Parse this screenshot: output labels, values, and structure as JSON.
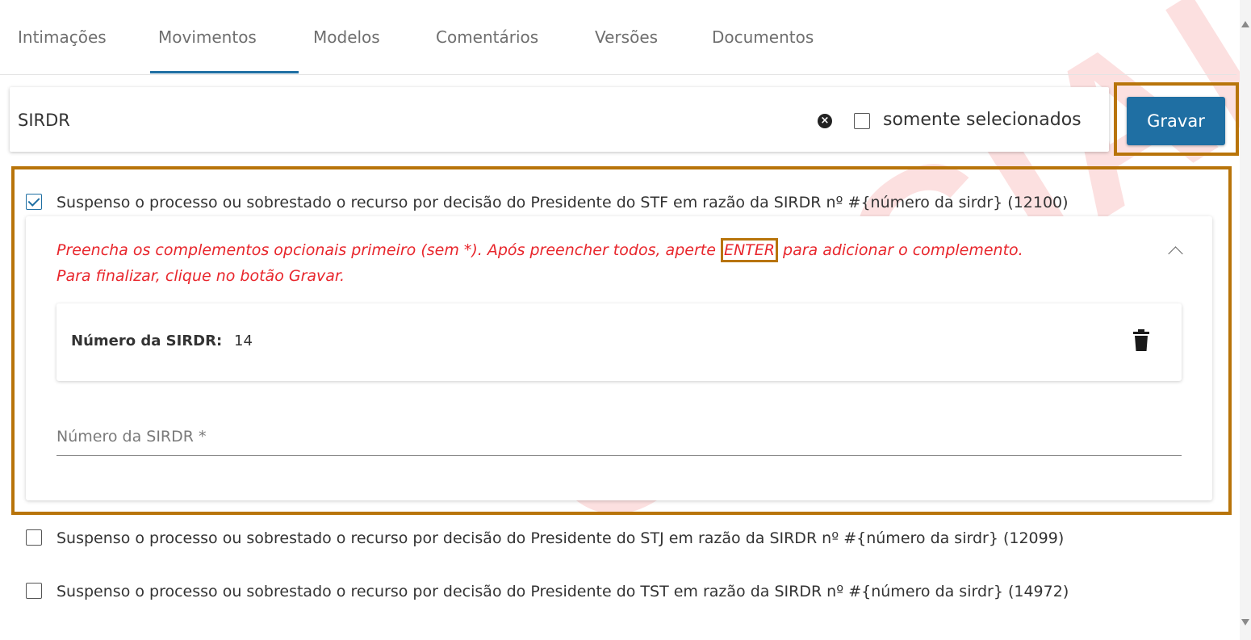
{
  "tabs": [
    {
      "label": "Intimações",
      "active": false
    },
    {
      "label": "Movimentos",
      "active": true
    },
    {
      "label": "Modelos",
      "active": false
    },
    {
      "label": "Comentários",
      "active": false
    },
    {
      "label": "Versões",
      "active": false
    },
    {
      "label": "Documentos",
      "active": false
    }
  ],
  "filter": {
    "value": "SIRDR",
    "clear_icon": "clear-circle-icon",
    "only_selected_label": "somente selecionados",
    "only_selected_checked": false
  },
  "toolbar": {
    "save_label": "Gravar"
  },
  "movements": [
    {
      "label": "Suspenso o processo ou sobrestado o recurso por decisão do Presidente do STF em razão da SIRDR nº #{número da sirdr} (12100)",
      "checked": true
    },
    {
      "label": "Suspenso o processo ou sobrestado o recurso por decisão do Presidente do STJ em razão da SIRDR nº #{número da sirdr} (12099)",
      "checked": false
    },
    {
      "label": "Suspenso o processo ou sobrestado o recurso por decisão do Presidente do TST em razão da SIRDR nº #{número da sirdr} (14972)",
      "checked": false
    }
  ],
  "complement_panel": {
    "instruction_before": "Preencha os complementos opcionais primeiro (sem *). Após preencher todos, aperte ",
    "instruction_key": "ENTER",
    "instruction_after": " para adicionar o complemento.",
    "instruction_line2": "Para finalizar, clique no botão Gravar.",
    "added_item": {
      "label": "Número da SIRDR:",
      "value": "14"
    },
    "field_placeholder": "Número da SIRDR *",
    "field_value": ""
  },
  "watermark": "OFICIAL",
  "colors": {
    "accent": "#1f6fa3",
    "highlight_frame": "#b8740a",
    "instruction_text": "#e8262c"
  }
}
